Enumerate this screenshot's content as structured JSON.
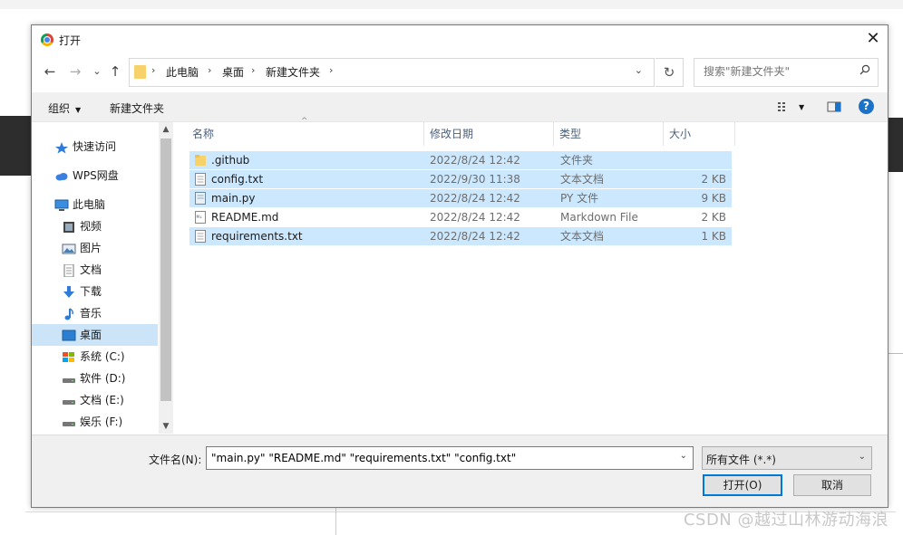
{
  "dialog": {
    "title": "打开",
    "close_glyph": "✕"
  },
  "nav_buttons": {
    "back": "←",
    "forward": "→",
    "recent": "⌄",
    "up": "↑"
  },
  "address": {
    "crumbs": [
      "此电脑",
      "桌面",
      "新建文件夹"
    ],
    "sep": "›",
    "dropdown": "⌄",
    "refresh_glyph": "↻"
  },
  "search": {
    "placeholder": "搜索\"新建文件夹\""
  },
  "toolbar": {
    "organize": "组织",
    "organize_caret": "▼",
    "new_folder": "新建文件夹",
    "view_caret": "▼",
    "help": "?"
  },
  "nav_pane": {
    "items": [
      {
        "label": "快速访问",
        "icon": "star-icon"
      },
      {
        "label": "WPS网盘",
        "icon": "cloud-icon"
      },
      {
        "label": "此电脑",
        "icon": "computer-icon"
      },
      {
        "label": "视频",
        "icon": "video-icon"
      },
      {
        "label": "图片",
        "icon": "picture-icon"
      },
      {
        "label": "文档",
        "icon": "document-icon"
      },
      {
        "label": "下载",
        "icon": "download-icon"
      },
      {
        "label": "音乐",
        "icon": "music-icon"
      },
      {
        "label": "桌面",
        "icon": "desktop-icon",
        "selected": true
      },
      {
        "label": "系统 (C:)",
        "icon": "drive-icon"
      },
      {
        "label": "软件 (D:)",
        "icon": "drive-icon"
      },
      {
        "label": "文档 (E:)",
        "icon": "drive-icon"
      },
      {
        "label": "娱乐 (F:)",
        "icon": "drive-icon"
      }
    ],
    "scroll_up": "▲",
    "scroll_down": "▼"
  },
  "file_list": {
    "columns": [
      "名称",
      "修改日期",
      "类型",
      "大小"
    ],
    "sort_caret": "^",
    "rows": [
      {
        "name": ".github",
        "date": "2022/8/24 12:42",
        "type": "文件夹",
        "size": "",
        "icon": "folder-icon",
        "selected": true
      },
      {
        "name": "config.txt",
        "date": "2022/9/30 11:38",
        "type": "文本文档",
        "size": "2 KB",
        "icon": "text-file-icon",
        "selected": true
      },
      {
        "name": "main.py",
        "date": "2022/8/24 12:42",
        "type": "PY 文件",
        "size": "9 KB",
        "icon": "python-file-icon",
        "selected": true
      },
      {
        "name": "README.md",
        "date": "2022/8/24 12:42",
        "type": "Markdown File",
        "size": "2 KB",
        "icon": "markdown-file-icon",
        "selected": false
      },
      {
        "name": "requirements.txt",
        "date": "2022/8/24 12:42",
        "type": "文本文档",
        "size": "1 KB",
        "icon": "text-file-icon",
        "selected": true
      }
    ]
  },
  "bottom": {
    "filename_label": "文件名(N):",
    "filename_value": "\"main.py\" \"README.md\" \"requirements.txt\" \"config.txt\"",
    "filter_value": "所有文件 (*.*)",
    "open_button": "打开(O)",
    "cancel_button": "取消",
    "dd_glyph": "⌄"
  },
  "watermark": "CSDN @越过山林游动海浪",
  "colors": {
    "selection": "#cce8ff",
    "nav_selection": "#cce4f7",
    "accent": "#0078d7",
    "folder": "#f7d26a"
  }
}
